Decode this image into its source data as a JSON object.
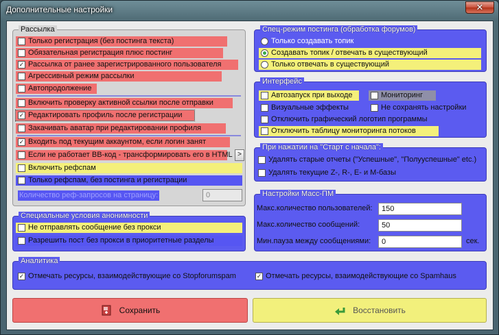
{
  "window": {
    "title": "Дополнительные настройки",
    "close_label": "✕"
  },
  "rassylka": {
    "legend": "Рассылка",
    "items": [
      {
        "label": "Только регистрация (без постинга текста)",
        "checked": false
      },
      {
        "label": "Обязательная регистрация плюс постинг",
        "checked": false
      },
      {
        "label": "Рассылка от ранее зарегистрированного пользователя",
        "checked": true
      },
      {
        "label": "Агрессивный режим рассылки",
        "checked": false
      },
      {
        "label": "Автопродолжение",
        "checked": false
      },
      {
        "label": "Включить проверку активной ссылки после отправки",
        "checked": false
      },
      {
        "label": "Редактировать профиль после регистрации",
        "checked": true
      },
      {
        "label": "Закачивать аватар при редактировании профиля",
        "checked": false
      },
      {
        "label": "Входить под текущим аккаунтом, если логин занят",
        "checked": true
      },
      {
        "label": "Если не работает ВВ-код - трансформировать его в HTML",
        "checked": false
      },
      {
        "label": "Включить рефспам",
        "checked": false
      },
      {
        "label": "Только рефспам, без постинга и регистрации",
        "checked": false
      }
    ],
    "more_button": ">",
    "ref_label": "Количество реф-запросов на страницу:",
    "ref_value": "0"
  },
  "anonymity": {
    "legend": "Специальные условия анонимности",
    "items": [
      {
        "label": "Не отправлять сообщение без прокси",
        "checked": false
      },
      {
        "label": "Разрешить пост без прокси в приоритетные разделы",
        "checked": false
      }
    ]
  },
  "posting_mode": {
    "legend": "Спец-режим постинга (обработка форумов)",
    "items": [
      {
        "label": "Только создавать топик",
        "selected": false
      },
      {
        "label": "Создавать топик / отвечать в существующий",
        "selected": true
      },
      {
        "label": "Только отвечать в существующий",
        "selected": false
      }
    ]
  },
  "interface": {
    "legend": "Интерфейс",
    "items": [
      {
        "label": "Автозапуск при выходе",
        "checked": false
      },
      {
        "label": "Мониторинг",
        "checked": false
      },
      {
        "label": "Визуальные эффекты",
        "checked": false
      },
      {
        "label": "Не сохранять настройки",
        "checked": false
      },
      {
        "label": "Отключить графический логотип программы",
        "checked": false
      },
      {
        "label": "Отключить таблицу мониторинга потоков",
        "checked": false
      }
    ]
  },
  "restart": {
    "legend": "При нажатии на \"Старт с начала\":",
    "items": [
      {
        "label": "Удалять старые отчеты (\"Успешные\", \"Полууспешные\" etc.)",
        "checked": false
      },
      {
        "label": "Удалять текущие Z-, R-, E- и M-базы",
        "checked": false
      }
    ]
  },
  "masspm": {
    "legend": "Настройки Масс-ПМ",
    "max_users_label": "Макс.количество пользователей:",
    "max_users_value": "150",
    "max_msgs_label": "Макс.количество сообщений:",
    "max_msgs_value": "50",
    "pause_label": "Мин.пауза между сообщениями:",
    "pause_value": "0",
    "pause_unit": "сек."
  },
  "analytics": {
    "legend": "Аналитика",
    "items": [
      {
        "label": "Отмечать ресурсы, взаимодействующие со Stopforumspam",
        "checked": true
      },
      {
        "label": "Отмечать ресурсы, взаимодействующие со Spamhaus",
        "checked": true
      }
    ]
  },
  "buttons": {
    "save_label": "Сохранить",
    "restore_label": "Восстановить"
  },
  "colors": {
    "red": "#f07070",
    "yellow": "#f4f07a",
    "blue": "#5656f2"
  },
  "icons": {
    "save": "save-icon",
    "restore": "restore-arrow-icon"
  }
}
